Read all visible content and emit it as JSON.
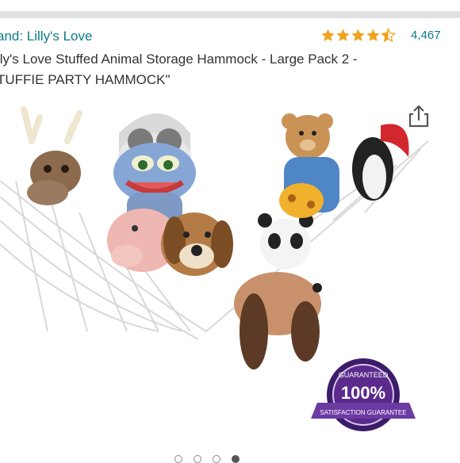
{
  "product": {
    "brand_line": "and: Lilly's Love",
    "title_line1": "lly's Love Stuffed Animal Storage Hammock - Large Pack 2 -",
    "title_line2": "TUFFIE PARTY HAMMOCK\"",
    "rating": 4.5,
    "review_count": "4,467"
  },
  "badge": {
    "top_text": "GUARANTEED",
    "center_text": "100%",
    "ribbon_text": "SATISFACTION GUARANTEE"
  },
  "icons": {
    "share": "share-icon",
    "star": "star-icon"
  },
  "gallery": {
    "image_count": 4,
    "active_index": 3
  },
  "colors": {
    "link": "#0b7a8a",
    "star": "#f0a41c",
    "badge_purple": "#5b2a8c"
  }
}
